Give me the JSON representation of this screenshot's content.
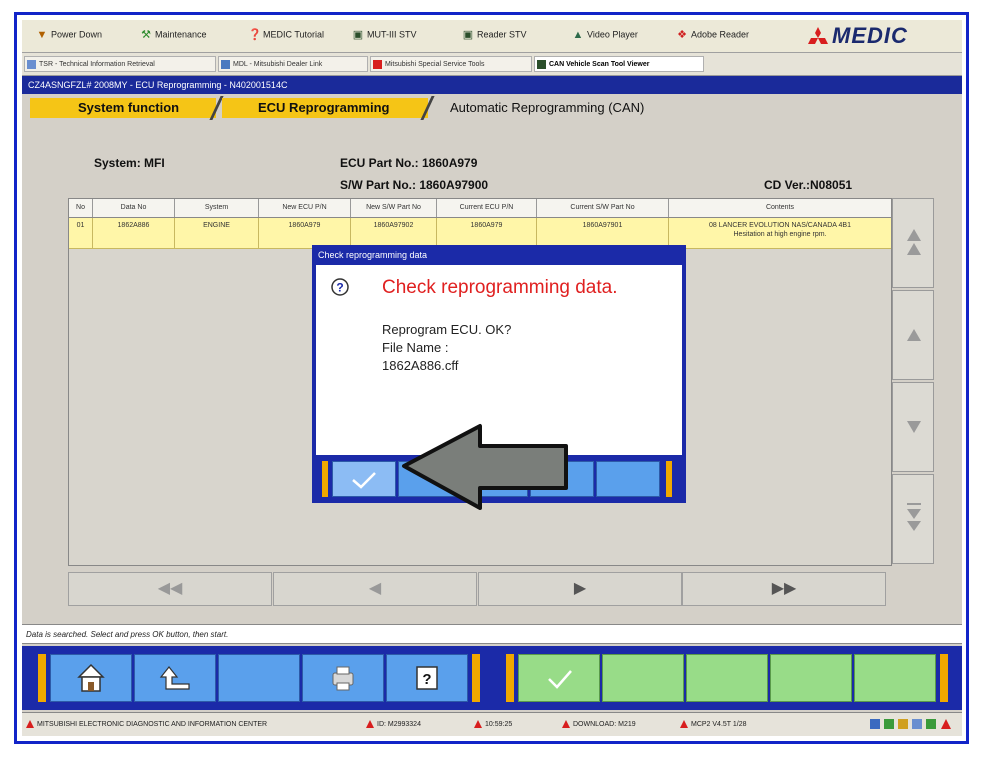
{
  "toolbar": {
    "items": [
      {
        "label": "Power Down",
        "icon": "power-icon"
      },
      {
        "label": "Maintenance",
        "icon": "maintenance-icon"
      },
      {
        "label": "MEDIC Tutorial",
        "icon": "tutorial-icon"
      },
      {
        "label": "MUT-III STV",
        "icon": "mut-icon"
      },
      {
        "label": "Reader STV",
        "icon": "reader-icon"
      },
      {
        "label": "Video Player",
        "icon": "video-icon"
      },
      {
        "label": "Adobe Reader",
        "icon": "adobe-icon"
      }
    ],
    "logo": "MEDIC"
  },
  "tasktabs": [
    {
      "label": "TSR - Technical Information Retrieval"
    },
    {
      "label": "MDL - Mitsubishi Dealer Link"
    },
    {
      "label": "Mitsubishi Special Service Tools"
    },
    {
      "label": "CAN Vehicle Scan Tool Viewer"
    }
  ],
  "breadcrumb": "CZ4ASNGFZL# 2008MY  -  ECU Reprogramming  -  N402001514C",
  "steps": {
    "step1": "System function",
    "step2": "ECU Reprogramming",
    "step3": "Automatic Reprogramming (CAN)"
  },
  "info": {
    "system": "System: MFI",
    "ecu_part": "ECU Part No.: 1860A979",
    "sw_part": "S/W Part No.: 1860A97900",
    "cd_ver": "CD Ver.:N08051"
  },
  "table": {
    "headers": [
      "No",
      "Data No",
      "System",
      "New ECU P/N",
      "New S/W Part No",
      "Current ECU P/N",
      "Current S/W Part No",
      "Contents"
    ],
    "rows": [
      {
        "no": "01",
        "data_no": "1862A886",
        "system": "ENGINE",
        "new_ecu": "1860A979",
        "new_sw": "1860A97902",
        "cur_ecu": "1860A979",
        "cur_sw": "1860A97901",
        "contents_1": "08 LANCER EVOLUTION NAS/CANADA 4B1",
        "contents_2": "Hesitation at high engine rpm."
      }
    ]
  },
  "status": "Data is searched. Select and press OK button, then start.",
  "footer": {
    "center": "MITSUBISHI ELECTRONIC DIAGNOSTIC AND INFORMATION CENTER",
    "id": "ID: M2993324",
    "time": "10:59:25",
    "download": "DOWNLOAD: M219",
    "mcp": "MCP2 V4.5T 1/28"
  },
  "dialog": {
    "title": "Check reprogramming data",
    "heading": "Check reprogramming data.",
    "line1": "Reprogram ECU. OK?",
    "line2": "File Name :",
    "line3": "1862A886.cff"
  },
  "colors": {
    "accent_blue": "#1b2aa8",
    "key_blue": "#5aa0ec",
    "key_green": "#98dc88",
    "tab_yellow": "#f5c516",
    "row_yellow": "#fff6a8",
    "alert_red": "#e02020"
  }
}
